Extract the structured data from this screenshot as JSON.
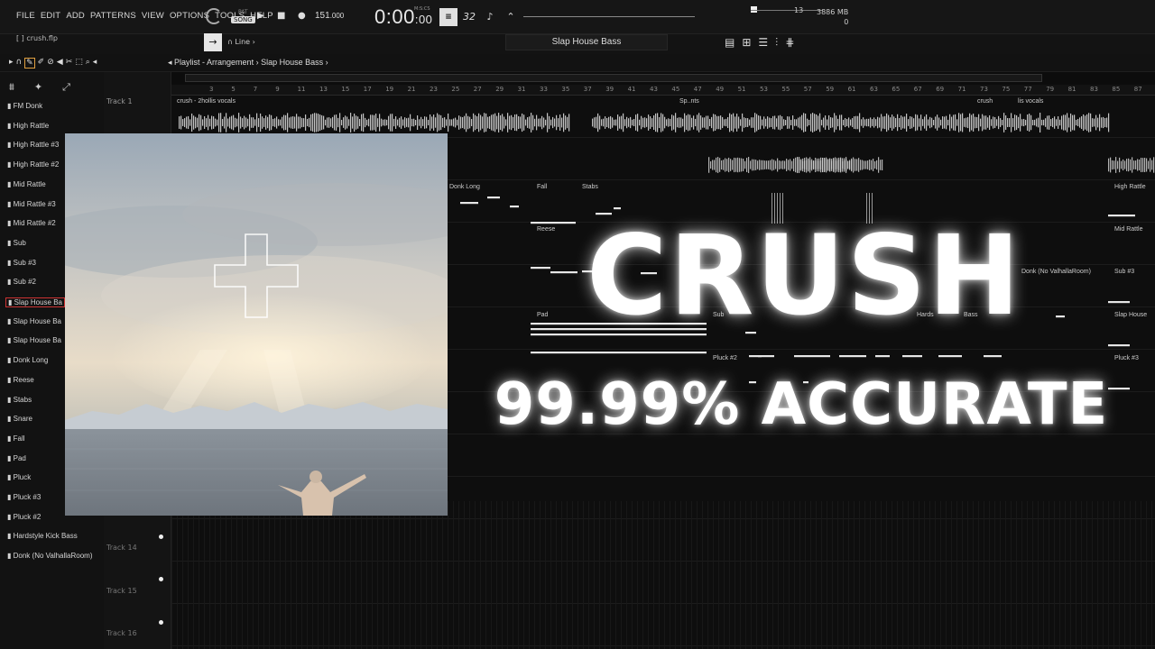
{
  "menu": [
    "FILE",
    "EDIT",
    "ADD",
    "PATTERNS",
    "VIEW",
    "OPTIONS",
    "TOOLS",
    "HELP"
  ],
  "transport": {
    "pat_label": "PAT",
    "song_label": "SONG",
    "bpm": "151",
    "bpm_decimal": ".000",
    "time_main": "0:00",
    "time_sub": ":00",
    "mscs": "M:S:CS",
    "meter_label": "32",
    "cpu_val": "13",
    "mem_val": "3886 MB",
    "poly_val": "0"
  },
  "project": {
    "file": "[  ] crush.flp",
    "snap": "Line",
    "pattern": "Slap House Bass"
  },
  "breadcrumb": "Playlist - Arrangement  ›  Slap House Bass  ›",
  "ruler": [
    "3",
    "5",
    "7",
    "9",
    "11",
    "13",
    "15",
    "17",
    "19",
    "21",
    "23",
    "25",
    "27",
    "29",
    "31",
    "33",
    "35",
    "37",
    "39",
    "41",
    "43",
    "45",
    "47",
    "49",
    "51",
    "53",
    "55",
    "57",
    "59",
    "61",
    "63",
    "65",
    "67",
    "69",
    "71",
    "73",
    "75",
    "77",
    "79",
    "81",
    "83",
    "85",
    "87"
  ],
  "tracks": {
    "track1": "Track 1",
    "track14": "Track 14",
    "track15": "Track 15",
    "track16": "Track 16"
  },
  "channels": [
    "FM Donk",
    "High Rattle",
    "High Rattle #3",
    "High Rattle #2",
    "Mid Rattle",
    "Mid Rattle #3",
    "Mid Rattle #2",
    "Sub",
    "Sub #3",
    "Sub #2",
    "Slap House Ba",
    "Slap House Ba",
    "Slap House Ba",
    "Donk Long",
    "Reese",
    "Stabs",
    "Snare",
    "Fall",
    "Pad",
    "Pluck",
    "Pluck #3",
    "Pluck #2",
    "Hardstyle Kick Bass",
    "Donk (No ValhallaRoom)"
  ],
  "clips": {
    "vocals1": "crush - 2hollis vocals",
    "vocals2": "Sp..nts",
    "vocals3": "crush",
    "vocals4": "lis vocals",
    "donk_long": "Donk Long",
    "fall": "Fall",
    "stabs": "Stabs",
    "high_rattle": "High Rattle",
    "reese": "Reese",
    "mid_rattle": "Mid Rattle",
    "donk_noval": "Donk (No ValhallaRoom)",
    "sub3": "Sub #3",
    "pad": "Pad",
    "sub": "Sub",
    "hardstyle": "Hards",
    "bass": "Bass",
    "slap": "Slap House",
    "pluck2": "Pluck #2",
    "pluck3": "Pluck #3"
  },
  "headline": {
    "title": "CRUSH",
    "subtitle": "99.99% ACCURATE"
  },
  "colors": {
    "accent": "#e0a040",
    "active_border": "#cc3333"
  }
}
